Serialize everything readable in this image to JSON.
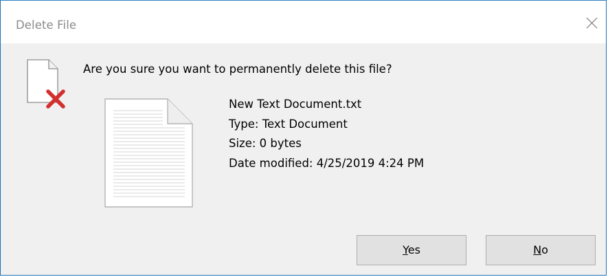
{
  "window": {
    "title": "Delete File"
  },
  "icons": {
    "close": "close-icon",
    "warning": "delete-file-warning-icon",
    "file": "text-document-icon"
  },
  "colors": {
    "dialog_bg": "#f0f0f0",
    "titlebar_bg": "#ffffff",
    "title_text": "#8a8a8a",
    "delete_x": "#d32f2f",
    "button_bg": "#e1e1e1",
    "button_border": "#adadad",
    "window_border": "#1a6fb8"
  },
  "message": {
    "question": "Are you sure you want to permanently delete this file?"
  },
  "file": {
    "name": "New Text Document.txt",
    "type": "Type: Text Document",
    "size": "Size: 0 bytes",
    "date_modified": "Date modified: 4/25/2019 4:24 PM"
  },
  "buttons": {
    "yes": {
      "accelerator": "Y",
      "rest": "es"
    },
    "no": {
      "accelerator": "N",
      "rest": "o"
    }
  }
}
